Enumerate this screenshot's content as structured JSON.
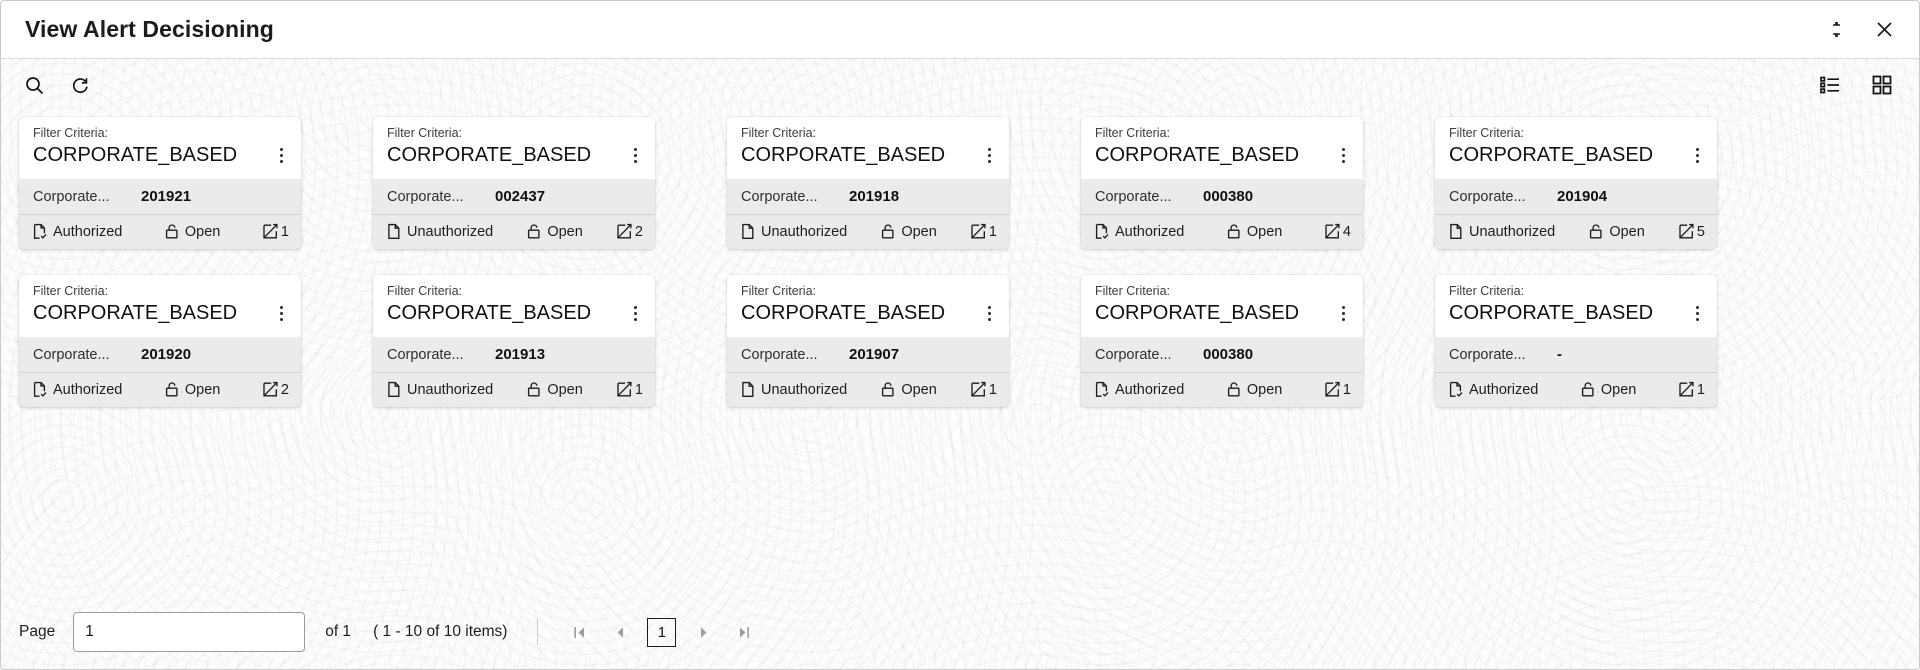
{
  "window": {
    "title": "View Alert Decisioning",
    "actions": [
      {
        "name": "minimize-restore-icon",
        "label": "Restore"
      },
      {
        "name": "close-icon",
        "label": "Close"
      }
    ]
  },
  "toolbar": {
    "left": [
      {
        "name": "search-icon",
        "label": "Search"
      },
      {
        "name": "refresh-icon",
        "label": "Refresh"
      }
    ],
    "right": [
      {
        "name": "list-view-icon",
        "label": "List View"
      },
      {
        "name": "grid-view-icon",
        "label": "Grid View"
      }
    ]
  },
  "card_labels": {
    "filter_criteria": "Filter Criteria:",
    "field_key": "Corporate...",
    "menu": "More options"
  },
  "cards": [
    {
      "filter_label": "Filter Criteria:",
      "filter_value": "CORPORATE_BASED",
      "field_key": "Corporate...",
      "field_value": "201921",
      "status": "Authorized",
      "status_icon": "document-check-icon",
      "lock": "Open",
      "lock_icon": "unlock-icon",
      "count": "1",
      "count_icon": "edit-icon"
    },
    {
      "filter_label": "Filter Criteria:",
      "filter_value": "CORPORATE_BASED",
      "field_key": "Corporate...",
      "field_value": "002437",
      "status": "Unauthorized",
      "status_icon": "document-icon",
      "lock": "Open",
      "lock_icon": "unlock-icon",
      "count": "2",
      "count_icon": "edit-icon"
    },
    {
      "filter_label": "Filter Criteria:",
      "filter_value": "CORPORATE_BASED",
      "field_key": "Corporate...",
      "field_value": "201918",
      "status": "Unauthorized",
      "status_icon": "document-icon",
      "lock": "Open",
      "lock_icon": "unlock-icon",
      "count": "1",
      "count_icon": "edit-icon"
    },
    {
      "filter_label": "Filter Criteria:",
      "filter_value": "CORPORATE_BASED",
      "field_key": "Corporate...",
      "field_value": "000380",
      "status": "Authorized",
      "status_icon": "document-check-icon",
      "lock": "Open",
      "lock_icon": "unlock-icon",
      "count": "4",
      "count_icon": "edit-icon"
    },
    {
      "filter_label": "Filter Criteria:",
      "filter_value": "CORPORATE_BASED",
      "field_key": "Corporate...",
      "field_value": "201904",
      "status": "Unauthorized",
      "status_icon": "document-icon",
      "lock": "Open",
      "lock_icon": "unlock-icon",
      "count": "5",
      "count_icon": "edit-icon"
    },
    {
      "filter_label": "Filter Criteria:",
      "filter_value": "CORPORATE_BASED",
      "field_key": "Corporate...",
      "field_value": "201920",
      "status": "Authorized",
      "status_icon": "document-check-icon",
      "lock": "Open",
      "lock_icon": "unlock-icon",
      "count": "2",
      "count_icon": "edit-icon"
    },
    {
      "filter_label": "Filter Criteria:",
      "filter_value": "CORPORATE_BASED",
      "field_key": "Corporate...",
      "field_value": "201913",
      "status": "Unauthorized",
      "status_icon": "document-icon",
      "lock": "Open",
      "lock_icon": "unlock-icon",
      "count": "1",
      "count_icon": "edit-icon"
    },
    {
      "filter_label": "Filter Criteria:",
      "filter_value": "CORPORATE_BASED",
      "field_key": "Corporate...",
      "field_value": "201907",
      "status": "Unauthorized",
      "status_icon": "document-icon",
      "lock": "Open",
      "lock_icon": "unlock-icon",
      "count": "1",
      "count_icon": "edit-icon"
    },
    {
      "filter_label": "Filter Criteria:",
      "filter_value": "CORPORATE_BASED",
      "field_key": "Corporate...",
      "field_value": "000380",
      "status": "Authorized",
      "status_icon": "document-check-icon",
      "lock": "Open",
      "lock_icon": "unlock-icon",
      "count": "1",
      "count_icon": "edit-icon"
    },
    {
      "filter_label": "Filter Criteria:",
      "filter_value": "CORPORATE_BASED",
      "field_key": "Corporate...",
      "field_value": "-",
      "status": "Authorized",
      "status_icon": "document-check-icon",
      "lock": "Open",
      "lock_icon": "unlock-icon",
      "count": "1",
      "count_icon": "edit-icon"
    }
  ],
  "pagination": {
    "page_label": "Page",
    "page_value": "1",
    "page_placeholder": "",
    "of_text": "of 1",
    "items_text": "( 1 - 10 of 10 items)",
    "current_page": "1",
    "first_label": "First page",
    "prev_label": "Previous page",
    "next_label": "Next page",
    "last_label": "Last page"
  },
  "colors": {
    "card_bg": "#ffffff",
    "card_body_bg": "#ebebeb",
    "text": "#111111",
    "muted": "#3d3d3d",
    "arrow_disabled": "#9d9d9d"
  }
}
